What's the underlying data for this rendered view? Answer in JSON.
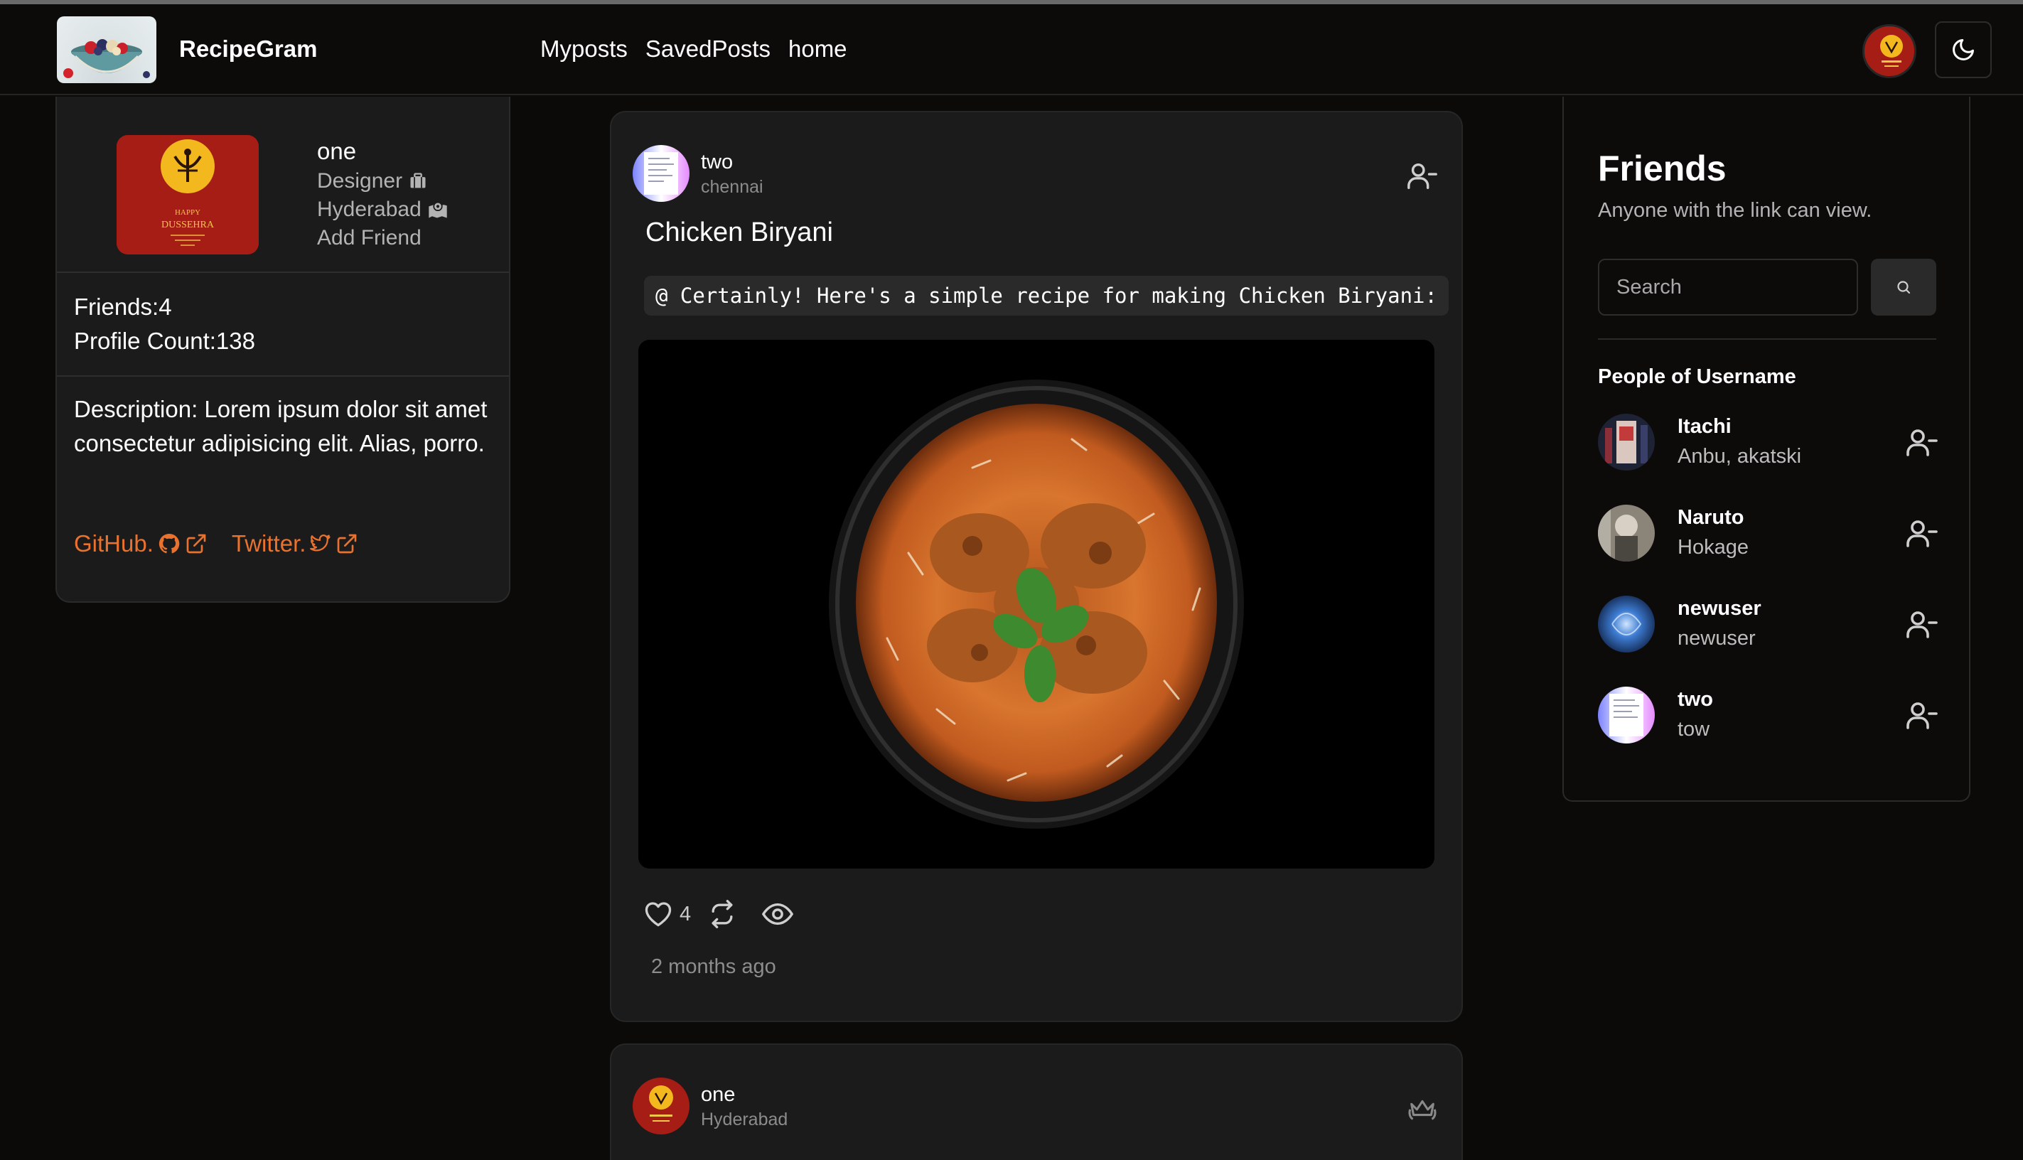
{
  "app": {
    "brand": "RecipeGram",
    "nav": [
      "Myposts",
      "SavedPosts",
      "home"
    ]
  },
  "profile": {
    "name": "one",
    "role": "Designer",
    "city": "Hyderabad",
    "add_friend": "Add Friend",
    "image_text": {
      "line1": "HAPPY",
      "line2": "DUSSEHRA"
    },
    "friends": "Friends:4",
    "profile_count": "Profile Count:138",
    "description": "Description: Lorem ipsum dolor sit amet consectetur adipisicing elit. Alias, porro.",
    "links": [
      {
        "label": "GitHub."
      },
      {
        "label": "Twitter."
      }
    ]
  },
  "feed": {
    "posts": [
      {
        "username": "two",
        "location": "chennai",
        "title": "Chicken Biryani",
        "snippet": "@ Certainly! Here's a simple recipe for making Chicken Biryani:",
        "likes": "4",
        "time": "2 months ago"
      },
      {
        "username": "one",
        "location": "Hyderabad"
      }
    ]
  },
  "friends_panel": {
    "title": "Friends",
    "subtitle": "Anyone with the link can view.",
    "search_placeholder": "Search",
    "people_heading": "People of Username",
    "people": [
      {
        "name": "Itachi",
        "sub": "Anbu, akatski"
      },
      {
        "name": "Naruto",
        "sub": "Hokage"
      },
      {
        "name": "newuser",
        "sub": "newuser"
      },
      {
        "name": "two",
        "sub": "tow"
      }
    ]
  },
  "colors": {
    "background": "#0b0a09",
    "card": "#1b1b1b",
    "link_accent": "#e8722e"
  },
  "icons": {
    "post_action_1": "user-minus-icon",
    "post_action_2": "crown-icon",
    "search": "search-icon",
    "theme": "moon-icon",
    "like": "heart-icon",
    "repost": "repeat-icon",
    "views": "eye-icon"
  }
}
